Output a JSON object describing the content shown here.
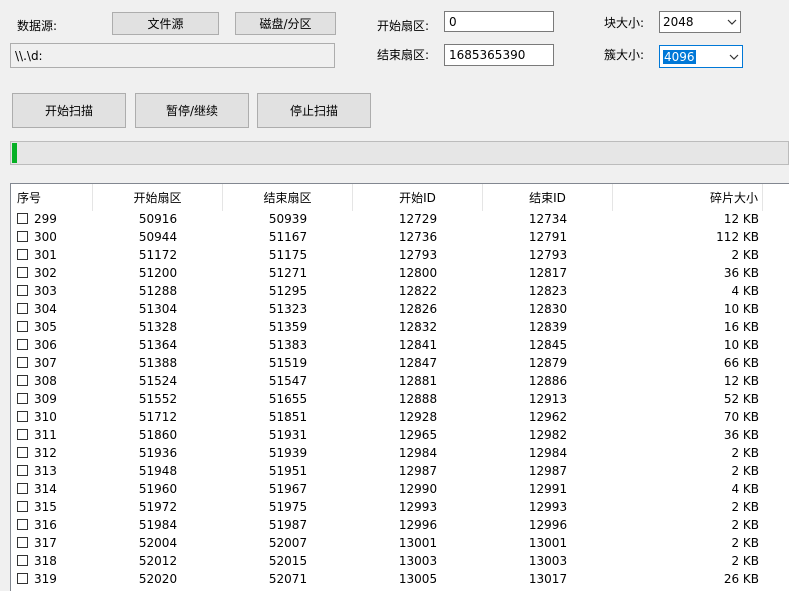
{
  "source": {
    "label": "数据源:",
    "file_button": "文件源",
    "disk_button": "磁盘/分区",
    "path": "\\\\.\\d:"
  },
  "sectors": {
    "start_label": "开始扇区:",
    "start_value": "0",
    "end_label": "结束扇区:",
    "end_value": "1685365390"
  },
  "sizes": {
    "block_label": "块大小:",
    "block_value": "2048",
    "cluster_label": "簇大小:",
    "cluster_value": "4096"
  },
  "actions": {
    "start": "开始扫描",
    "pause": "暂停/继续",
    "stop": "停止扫描"
  },
  "progress": {
    "percent": 0.6
  },
  "table": {
    "columns": [
      "序号",
      "开始扇区",
      "结束扇区",
      "开始ID",
      "结束ID",
      "碎片大小"
    ],
    "rows": [
      [
        "299",
        "50916",
        "50939",
        "12729",
        "12734",
        "12 KB"
      ],
      [
        "300",
        "50944",
        "51167",
        "12736",
        "12791",
        "112 KB"
      ],
      [
        "301",
        "51172",
        "51175",
        "12793",
        "12793",
        "2 KB"
      ],
      [
        "302",
        "51200",
        "51271",
        "12800",
        "12817",
        "36 KB"
      ],
      [
        "303",
        "51288",
        "51295",
        "12822",
        "12823",
        "4 KB"
      ],
      [
        "304",
        "51304",
        "51323",
        "12826",
        "12830",
        "10 KB"
      ],
      [
        "305",
        "51328",
        "51359",
        "12832",
        "12839",
        "16 KB"
      ],
      [
        "306",
        "51364",
        "51383",
        "12841",
        "12845",
        "10 KB"
      ],
      [
        "307",
        "51388",
        "51519",
        "12847",
        "12879",
        "66 KB"
      ],
      [
        "308",
        "51524",
        "51547",
        "12881",
        "12886",
        "12 KB"
      ],
      [
        "309",
        "51552",
        "51655",
        "12888",
        "12913",
        "52 KB"
      ],
      [
        "310",
        "51712",
        "51851",
        "12928",
        "12962",
        "70 KB"
      ],
      [
        "311",
        "51860",
        "51931",
        "12965",
        "12982",
        "36 KB"
      ],
      [
        "312",
        "51936",
        "51939",
        "12984",
        "12984",
        "2 KB"
      ],
      [
        "313",
        "51948",
        "51951",
        "12987",
        "12987",
        "2 KB"
      ],
      [
        "314",
        "51960",
        "51967",
        "12990",
        "12991",
        "4 KB"
      ],
      [
        "315",
        "51972",
        "51975",
        "12993",
        "12993",
        "2 KB"
      ],
      [
        "316",
        "51984",
        "51987",
        "12996",
        "12996",
        "2 KB"
      ],
      [
        "317",
        "52004",
        "52007",
        "13001",
        "13001",
        "2 KB"
      ],
      [
        "318",
        "52012",
        "52015",
        "13003",
        "13003",
        "2 KB"
      ],
      [
        "319",
        "52020",
        "52071",
        "13005",
        "13017",
        "26 KB"
      ]
    ]
  }
}
